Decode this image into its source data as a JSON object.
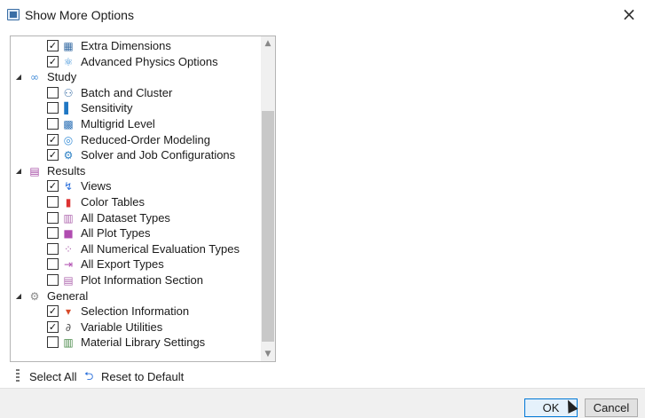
{
  "window": {
    "title": "Show More Options",
    "close_glyph": "×"
  },
  "tree": {
    "rows": [
      {
        "label": "Extra Dimensions",
        "type": "child",
        "checked": true,
        "icon": "extra-dimensions-icon"
      },
      {
        "label": "Advanced Physics Options",
        "type": "child",
        "checked": true,
        "icon": "atom-icon"
      },
      {
        "label": "Study",
        "type": "group",
        "icon": "study-icon"
      },
      {
        "label": "Batch and Cluster",
        "type": "child",
        "checked": false,
        "icon": "batch-cluster-icon"
      },
      {
        "label": "Sensitivity",
        "type": "child",
        "checked": false,
        "icon": "sensitivity-icon"
      },
      {
        "label": "Multigrid Level",
        "type": "child",
        "checked": false,
        "icon": "multigrid-icon"
      },
      {
        "label": "Reduced-Order Modeling",
        "type": "child",
        "checked": true,
        "icon": "reduced-order-icon"
      },
      {
        "label": "Solver and Job Configurations",
        "type": "child",
        "checked": true,
        "icon": "solver-icon"
      },
      {
        "label": "Results",
        "type": "group",
        "icon": "results-icon"
      },
      {
        "label": "Views",
        "type": "child",
        "checked": true,
        "icon": "views-icon"
      },
      {
        "label": "Color Tables",
        "type": "child",
        "checked": false,
        "icon": "color-tables-icon"
      },
      {
        "label": "All Dataset Types",
        "type": "child",
        "checked": false,
        "icon": "dataset-icon"
      },
      {
        "label": "All Plot Types",
        "type": "child",
        "checked": false,
        "icon": "plot-icon"
      },
      {
        "label": "All Numerical Evaluation Types",
        "type": "child",
        "checked": false,
        "icon": "numerical-eval-icon"
      },
      {
        "label": "All Export Types",
        "type": "child",
        "checked": false,
        "icon": "export-icon"
      },
      {
        "label": "Plot Information Section",
        "type": "child",
        "checked": false,
        "icon": "plot-info-icon"
      },
      {
        "label": "General",
        "type": "group",
        "icon": "gear-icon"
      },
      {
        "label": "Selection Information",
        "type": "child",
        "checked": true,
        "icon": "selection-info-icon"
      },
      {
        "label": "Variable Utilities",
        "type": "child",
        "checked": true,
        "icon": "variable-utilities-icon"
      },
      {
        "label": "Material Library Settings",
        "type": "child",
        "checked": false,
        "icon": "material-library-icon"
      }
    ]
  },
  "toolbar": {
    "select_all_label": "Select All",
    "reset_label": "Reset to Default"
  },
  "footer": {
    "ok_label": "OK",
    "cancel_label": "Cancel"
  },
  "colors": {
    "accent": "#0078d7",
    "study_icon": "#4a90d9",
    "results_icon": "#a64ca6"
  }
}
